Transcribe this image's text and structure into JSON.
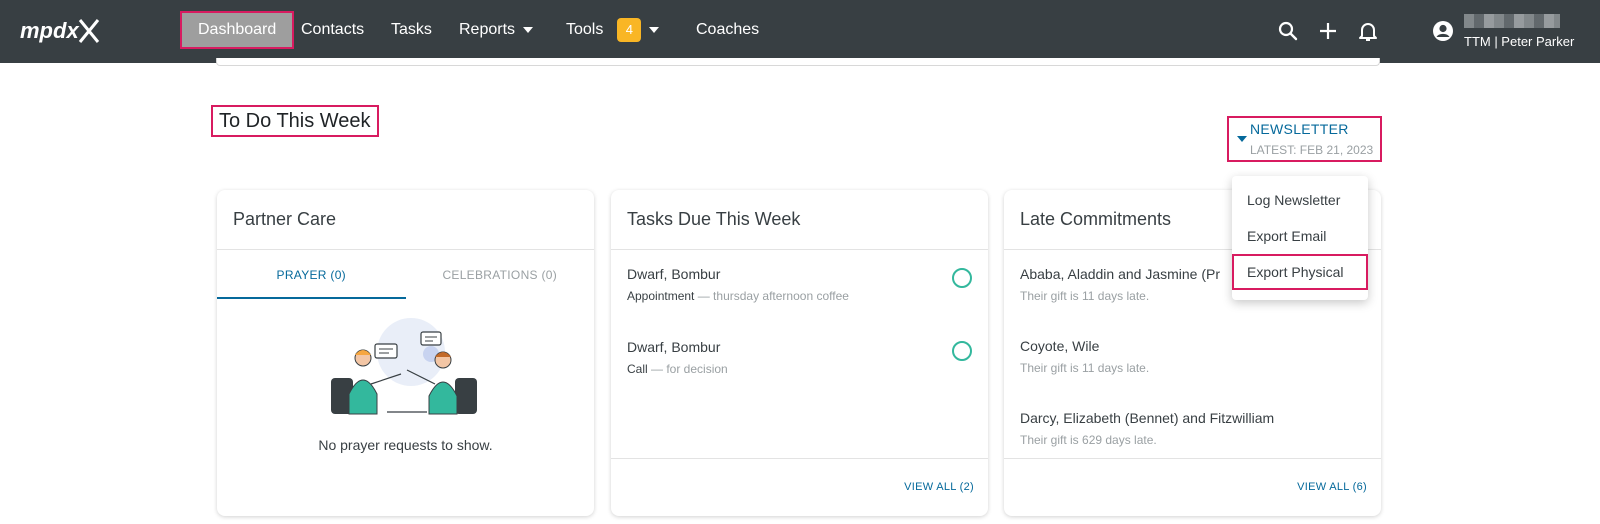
{
  "nav": {
    "logo_text": "mpdx",
    "items": [
      {
        "label": "Dashboard"
      },
      {
        "label": "Contacts"
      },
      {
        "label": "Tasks"
      },
      {
        "label": "Reports"
      },
      {
        "label": "Tools"
      },
      {
        "label": "Coaches"
      }
    ],
    "tools_badge": "4",
    "user_name": "TTM | Peter Parker",
    "icons": [
      "search-icon",
      "plus-icon",
      "bell-icon",
      "account-circle-icon"
    ]
  },
  "section": {
    "title": "To Do This Week"
  },
  "newsletter": {
    "title": "NEWSLETTER",
    "latest": "LATEST: FEB 21, 2023",
    "menu": [
      "Log Newsletter",
      "Export Email",
      "Export Physical"
    ]
  },
  "cards": {
    "partner_care": {
      "title": "Partner Care",
      "tabs": [
        "PRAYER (0)",
        "CELEBRATIONS (0)"
      ],
      "empty_message": "No prayer requests to show."
    },
    "tasks_due": {
      "title": "Tasks Due This Week",
      "items": [
        {
          "name": "Dwarf, Bombur",
          "type": "Appointment",
          "detail": " — thursday afternoon coffee"
        },
        {
          "name": "Dwarf, Bombur",
          "type": "Call",
          "detail": " — for decision"
        }
      ],
      "view_all": "VIEW ALL (2)"
    },
    "late_commitments": {
      "title": "Late Commitments",
      "items": [
        {
          "name": "Ababa, Aladdin and Jasmine (Pr",
          "sub": "Their gift is 11 days late."
        },
        {
          "name": "Coyote, Wile",
          "sub": "Their gift is 11 days late."
        },
        {
          "name": "Darcy, Elizabeth (Bennet) and Fitzwilliam",
          "sub": "Their gift is 629 days late."
        }
      ],
      "view_all": "VIEW ALL (6)"
    }
  },
  "colors": {
    "navbar": "#383f43",
    "accent": "#05699b",
    "highlight_border": "#d81b60",
    "badge": "#f9b625",
    "task_circle": "#33b89d"
  }
}
